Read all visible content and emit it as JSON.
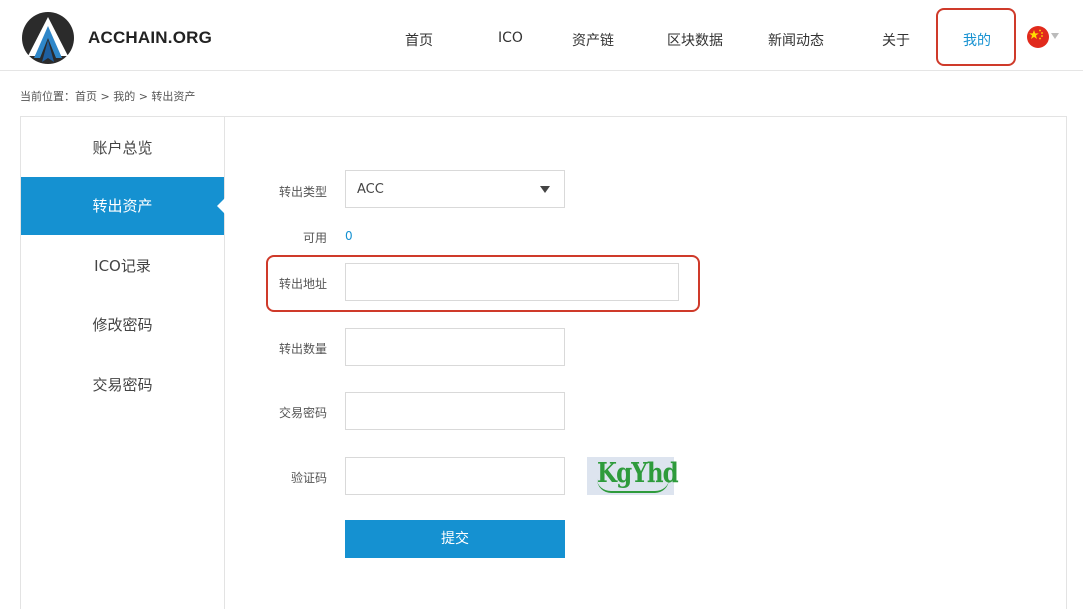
{
  "brand": {
    "name": "ACCHAIN.ORG"
  },
  "nav": {
    "items": [
      {
        "label": "首页"
      },
      {
        "label": "ICO"
      },
      {
        "label": "资产链"
      },
      {
        "label": "区块数据"
      },
      {
        "label": "新闻动态"
      },
      {
        "label": "关于"
      },
      {
        "label": "我的",
        "active": true
      }
    ],
    "language_icon": "china-flag-icon"
  },
  "breadcrumb": {
    "text": "当前位置：首页 > 我的 > 转出资产"
  },
  "sidebar": {
    "items": [
      {
        "label": "账户总览"
      },
      {
        "label": "转出资产",
        "active": true
      },
      {
        "label": "ICO记录"
      },
      {
        "label": "修改密码"
      },
      {
        "label": "交易密码"
      }
    ]
  },
  "form": {
    "type_label": "转出类型",
    "type_value": "ACC",
    "available_label": "可用",
    "available_value": "0",
    "address_label": "转出地址",
    "address_value": "",
    "amount_label": "转出数量",
    "amount_value": "",
    "trade_password_label": "交易密码",
    "trade_password_value": "",
    "captcha_label": "验证码",
    "captcha_value": "",
    "captcha_image_text": "KgYhd",
    "submit_label": "提交"
  },
  "colors": {
    "accent": "#1591d1",
    "highlight": "#cf3a2a",
    "captcha_green": "#2e9b3c"
  }
}
